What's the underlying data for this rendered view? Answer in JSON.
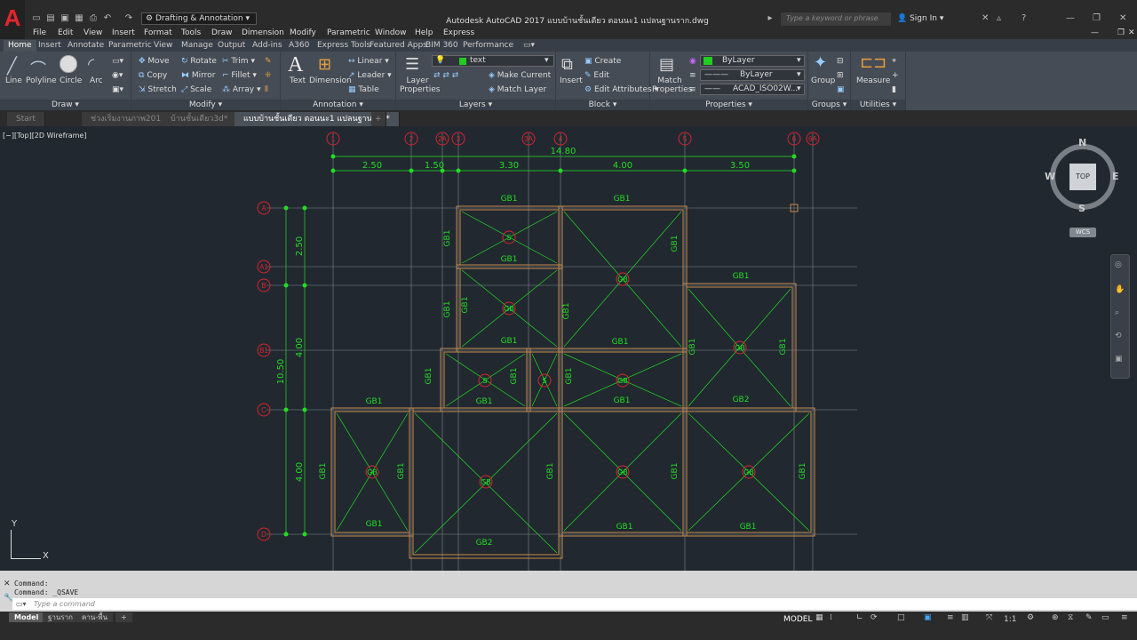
{
  "app": {
    "logo": "A",
    "workspace": "Drafting & Annotation",
    "title": "Autodesk AutoCAD 2017   แบบบ้านชั้นเดียว ตอนนะ1 แปลนฐานราก.dwg",
    "search_placeholder": "Type a keyword or phrase",
    "sign_in": "Sign In"
  },
  "menu": [
    "File",
    "Edit",
    "View",
    "Insert",
    "Format",
    "Tools",
    "Draw",
    "Dimension",
    "Modify",
    "Parametric",
    "Window",
    "Help",
    "Express"
  ],
  "ribbon_tabs": [
    "Home",
    "Insert",
    "Annotate",
    "Parametric",
    "View",
    "Manage",
    "Output",
    "Add-ins",
    "A360",
    "Express Tools",
    "Featured Apps",
    "BIM 360",
    "Performance"
  ],
  "draw_tools": [
    "Line",
    "Polyline",
    "Circle",
    "Arc"
  ],
  "modify_tools": [
    "Move",
    "Rotate",
    "Trim",
    "Copy",
    "Mirror",
    "Fillet",
    "Stretch",
    "Scale",
    "Array"
  ],
  "annotation_tools": [
    "Text",
    "Dimension",
    "Linear",
    "Leader",
    "Table"
  ],
  "layers": {
    "current": "text",
    "make_current": "Make Current",
    "match_layer": "Match Layer",
    "layer_properties": "Layer Properties"
  },
  "block": {
    "insert": "Insert",
    "create": "Create",
    "edit": "Edit",
    "edit_attributes": "Edit Attributes"
  },
  "properties": {
    "match": "Match Properties",
    "color": "ByLayer",
    "linetype": "ByLayer",
    "lineweight": "ACAD_ISO02W..."
  },
  "group_label": "Group",
  "measure_label": "Measure",
  "panel_titles": [
    "Draw",
    "Modify",
    "Annotation",
    "Layers",
    "Block",
    "Properties",
    "Groups",
    "Utilities"
  ],
  "doc_tabs": [
    "Start",
    "ช่วงเริ่มงานภาพ2017*",
    "บ้านชั้นเดียว3d*",
    "แบบบ้านชั้นเดียว ตอนนะ1 แปลนฐานราก*"
  ],
  "viewport_label": "[−][Top][2D Wireframe]",
  "viewcube": {
    "n": "N",
    "s": "S",
    "e": "E",
    "w": "W",
    "top": "TOP",
    "wcs": "WCS"
  },
  "ucs": {
    "x": "X",
    "y": "Y"
  },
  "drawing": {
    "grid_x": [
      "1",
      "2",
      "2A",
      "3",
      "3A",
      "4",
      "5",
      "6",
      "6A"
    ],
    "grid_y": [
      "A",
      "A1",
      "B",
      "B1",
      "C",
      "D"
    ],
    "dims_x": [
      "2.50",
      "1.50",
      "3.30",
      "4.00",
      "3.50"
    ],
    "total_x": "14.80",
    "dims_y": [
      "2.50",
      "4.00",
      "4.00"
    ],
    "total_y": "10.50",
    "beam_label_main": "GB1",
    "beam_label_alt": "GB2",
    "footing_gb": "GB",
    "footing_s": "S"
  },
  "command_history": [
    "Command:",
    "Command:  _QSAVE"
  ],
  "command_placeholder": "Type a command",
  "layout_tabs": [
    "Model",
    "ฐานราก",
    "คาน-พื้น"
  ],
  "status": {
    "model": "MODEL",
    "scale": "1:1"
  },
  "colors": {
    "grid": "#7d8590",
    "bubble": "#d9242c",
    "dim": "#22dd22",
    "beam": "#c98b4a",
    "footing": "#22dd22",
    "accent": "#e4252b"
  }
}
